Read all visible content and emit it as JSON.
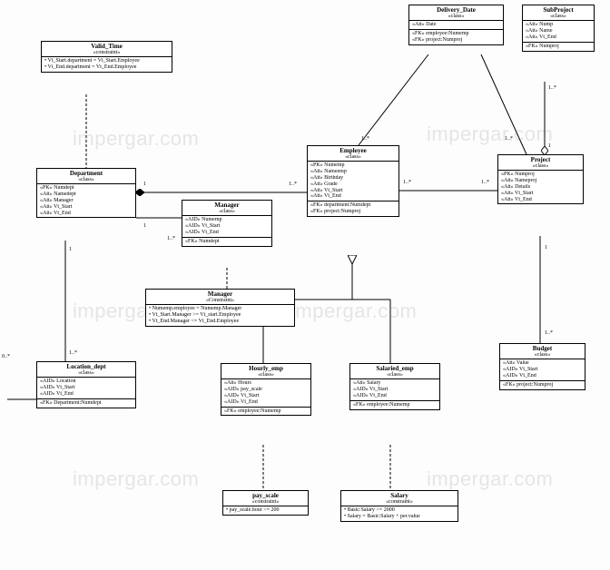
{
  "watermark": "impergar.com",
  "classes": {
    "valid_time": {
      "name": "Valid_Time",
      "stereo": "«constraint»",
      "rows": [
        "• Vt_Start.department = Vt_Start.Employee",
        "• Vt_End.department = Vt_End.Employee"
      ]
    },
    "delivery_date": {
      "name": "Delivery_Date",
      "stereo": "«class»",
      "rows": [
        "«Att» Date"
      ],
      "fks": [
        "«FK» employee:Numemp",
        "«FK» project:Numproj"
      ]
    },
    "subproject": {
      "name": "SubProject",
      "stereo": "«class»",
      "rows": [
        "«Att» Nump",
        "«Att» Name",
        "«Att» Vt_End"
      ],
      "fks": [
        "«FK» Numproj"
      ]
    },
    "department": {
      "name": "Department",
      "stereo": "«class»",
      "rows": [
        "«PK» Numdept",
        "«Att» Namedept",
        "«Att» Manager",
        "«Att» Vt_Start",
        "«Att» Vt_End"
      ]
    },
    "manager_class": {
      "name": "Manager",
      "stereo": "«class»",
      "rows": [
        "«AID» Numemp",
        "«AID» Vt_Start",
        "«AID» Vt_End"
      ],
      "fks": [
        "«FK» Numdept"
      ]
    },
    "manager_constraint": {
      "name": "Manager",
      "stereo": "«Constraint»",
      "rows": [
        "• Numemp.employee = Numemp.Manager",
        "• Vt_Start.Manager >= Vt_start.Employee",
        "• Vt_End.Manager <= Vt_End.Employee"
      ]
    },
    "employee": {
      "name": "Employee",
      "stereo": "«class»",
      "rows": [
        "«PK» Numemp",
        "«Att» Nameemp",
        "«Att» Birthday",
        "«Att» Grade",
        "«Att» Vt_Start",
        "«Att» Vt_End"
      ],
      "fks": [
        "«FK» department:Numdept",
        "«FK» project:Numproj"
      ]
    },
    "project": {
      "name": "Project",
      "stereo": "«class»",
      "rows": [
        "«PK» Numproj",
        "«Att» Nameproj",
        "«Att» Details",
        "«Att» Vt_Start",
        "«Att» Vt_End"
      ]
    },
    "location_dept": {
      "name": "Location_dept",
      "stereo": "«class»",
      "rows": [
        "«AID» Location",
        "«AID» Vt_Start",
        "«AID» Vt_End"
      ],
      "fks": [
        "«FK» Department:Numdept"
      ]
    },
    "hourly_emp": {
      "name": "Hourly_emp",
      "stereo": "«class»",
      "rows": [
        "«Att» Hours",
        "«AID» pay_scale",
        "«AID» Vt_Start",
        "«AID» Vt_End"
      ],
      "fks": [
        "«FK» employee:Numemp"
      ]
    },
    "salaried_emp": {
      "name": "Salaried_emp",
      "stereo": "«class»",
      "rows": [
        "«Att» Salary",
        "«AID» Vt_Start",
        "«AID» Vt_End"
      ],
      "fks": [
        "«FK» employee:Numemp"
      ]
    },
    "budget": {
      "name": "Budget",
      "stereo": "«class»",
      "rows": [
        "«Att» Value",
        "«AID» Vt_Start",
        "«AID» Vt_End"
      ],
      "fks": [
        "«FK» project:Numproj"
      ]
    },
    "pay_scale": {
      "name": "pay_scale",
      "stereo": "«constraint»",
      "rows": [
        "• pay_scale.hour >= 200"
      ]
    },
    "salary": {
      "name": "Salary",
      "stereo": "«constraint»",
      "rows": [
        "• Basic:Salary >= 2000",
        "• Salary = Basic:Salary + per.value"
      ]
    }
  },
  "labels": {
    "one": "1",
    "many": "1..*",
    "zero_many": "0..*"
  }
}
